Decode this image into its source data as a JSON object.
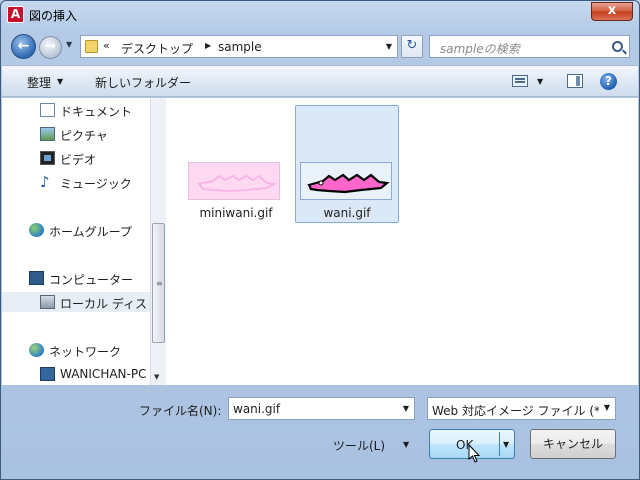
{
  "window": {
    "title": "図の挿入",
    "app_icon": "A",
    "close_glyph": "x"
  },
  "address_bar": {
    "back_glyph": "←",
    "forward_glyph": "→",
    "chevron": "«",
    "segments": [
      "デスクトップ",
      "sample"
    ],
    "refresh_glyph": "↻"
  },
  "search": {
    "placeholder": "sampleの検索"
  },
  "toolbar": {
    "organize_label": "整理",
    "new_folder_label": "新しいフォルダー",
    "help_glyph": "?"
  },
  "nav_pane": {
    "items": [
      {
        "label": "ドキュメント",
        "icon": "document-icon"
      },
      {
        "label": "ピクチャ",
        "icon": "pictures-icon"
      },
      {
        "label": "ビデオ",
        "icon": "video-icon"
      },
      {
        "label": "ミュージック",
        "icon": "music-icon"
      },
      {
        "label": "ホームグループ",
        "icon": "homegroup-icon"
      },
      {
        "label": "コンピューター",
        "icon": "computer-icon"
      },
      {
        "label": "ローカル ディス",
        "icon": "disk-icon"
      },
      {
        "label": "ネットワーク",
        "icon": "network-icon"
      },
      {
        "label": "WANICHAN-PC",
        "icon": "network-computer-icon"
      }
    ],
    "selected_index": 6
  },
  "files": [
    {
      "name": "miniwani.gif",
      "selected": false
    },
    {
      "name": "wani.gif",
      "selected": true
    }
  ],
  "bottom": {
    "filename_label": "ファイル名(N):",
    "filename_value": "wani.gif",
    "filter_value": "Web 対応イメージ ファイル (*",
    "tools_label": "ツール(L)",
    "ok_label": "OK",
    "cancel_label": "キャンセル"
  },
  "colors": {
    "selection": "#dbe8f8",
    "thumbnail_pink": "#ff66cc",
    "frame": "#b4cae6"
  }
}
